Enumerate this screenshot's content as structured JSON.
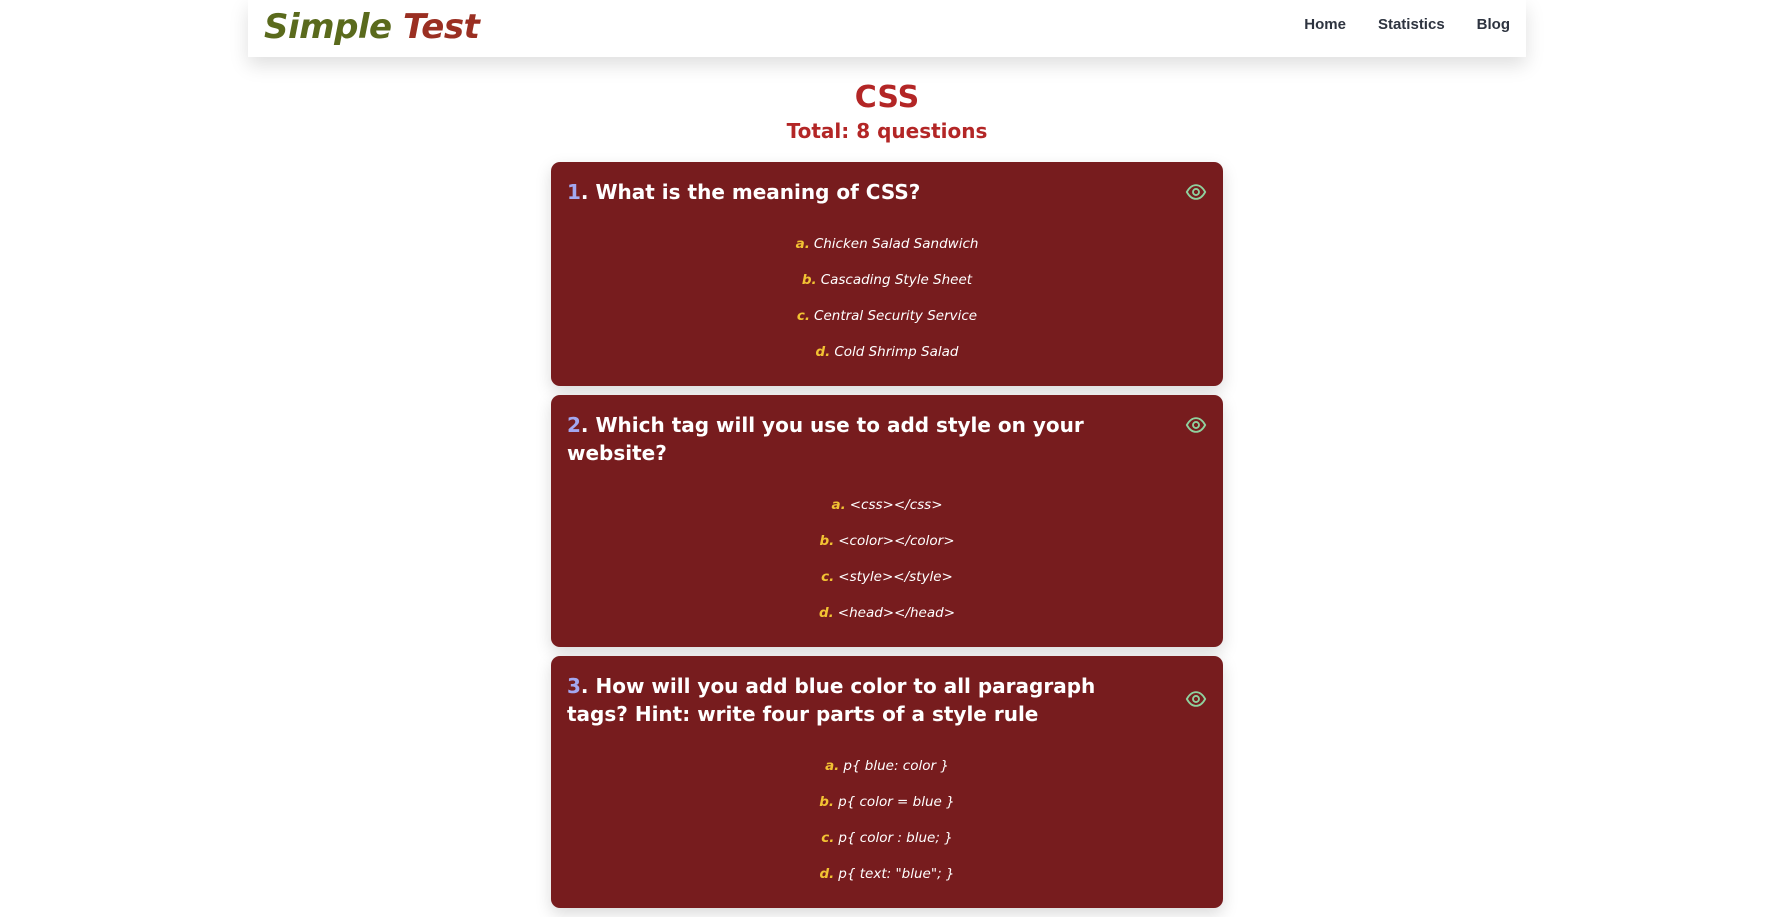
{
  "nav": {
    "logo_part1": "Simple",
    "logo_part2": "Test",
    "links": [
      "Home",
      "Statistics",
      "Blog"
    ]
  },
  "quiz": {
    "title": "CSS",
    "subtitle": "Total: 8 questions"
  },
  "questions": [
    {
      "number": "1",
      "text": "What is the meaning of CSS?",
      "options": [
        {
          "letter": "a.",
          "text": "Chicken Salad Sandwich"
        },
        {
          "letter": "b.",
          "text": "Cascading Style Sheet"
        },
        {
          "letter": "c.",
          "text": "Central Security Service"
        },
        {
          "letter": "d.",
          "text": "Cold Shrimp Salad"
        }
      ]
    },
    {
      "number": "2",
      "text": "Which tag will you use to add style on your website?",
      "options": [
        {
          "letter": "a.",
          "text": "<css></css>"
        },
        {
          "letter": "b.",
          "text": "<color></color>"
        },
        {
          "letter": "c.",
          "text": "<style></style>"
        },
        {
          "letter": "d.",
          "text": "<head></head>"
        }
      ]
    },
    {
      "number": "3",
      "text": "How will you add blue color to all paragraph tags? Hint: write four parts of a style rule",
      "options": [
        {
          "letter": "a.",
          "text": "p{ blue: color }"
        },
        {
          "letter": "b.",
          "text": "p{ color = blue }"
        },
        {
          "letter": "c.",
          "text": "p{ color : blue; }"
        },
        {
          "letter": "d.",
          "text": "p{ text: \"blue\"; }"
        }
      ]
    }
  ],
  "colors": {
    "card_background": "#771c1e",
    "heading_red": "#b32626",
    "option_letter": "#f2c233",
    "question_number": "#a3a7f0",
    "eye_icon": "#8fd19e"
  },
  "icons": {
    "reveal_answer": "eye-icon"
  }
}
